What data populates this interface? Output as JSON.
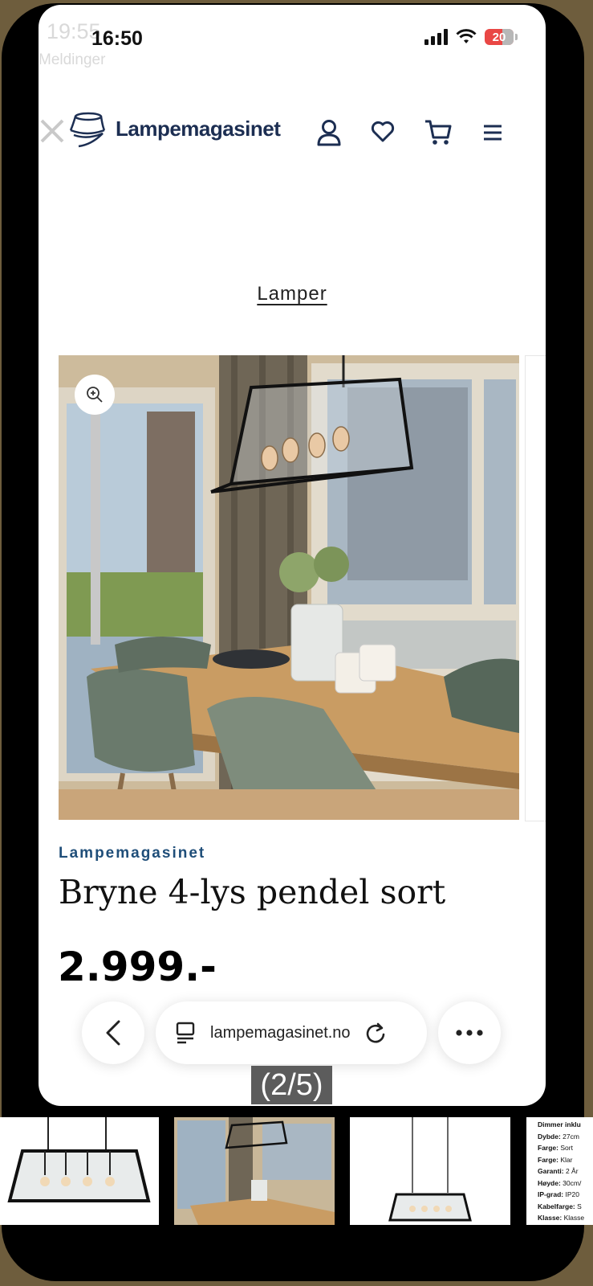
{
  "underlay": {
    "time": "19:55",
    "notification_label": "Meldinger"
  },
  "status_bar": {
    "time": "16:50",
    "battery": "20"
  },
  "header": {
    "logo_text": "Lampemagasinet",
    "icons": [
      "close-icon",
      "account-icon",
      "heart-icon",
      "cart-icon",
      "menu-icon"
    ]
  },
  "breadcrumb": "Lamper",
  "product": {
    "brand": "Lampemagasinet",
    "title": "Bryne 4-lys pendel sort",
    "price": "2.999.-"
  },
  "browser": {
    "url": "lampemagasinet.no",
    "icons": [
      "back-icon",
      "tabs-icon",
      "reload-icon",
      "more-icon"
    ]
  },
  "gallery": {
    "counter": "(2/5)"
  },
  "specs": [
    {
      "label": "Dimmer inklu",
      "value": ""
    },
    {
      "label": "Dybde:",
      "value": "27cm"
    },
    {
      "label": "Farge:",
      "value": "Sort"
    },
    {
      "label": "Farge:",
      "value": "Klar"
    },
    {
      "label": "Garanti:",
      "value": "2 År"
    },
    {
      "label": "Høyde:",
      "value": "30cm/"
    },
    {
      "label": "IP-grad:",
      "value": "IP20"
    },
    {
      "label": "Kabelfarge:",
      "value": "S"
    },
    {
      "label": "Klasse:",
      "value": "Klasse"
    }
  ],
  "colors": {
    "brand_navy": "#1c2e52",
    "brand_blue": "#1f4e79",
    "frame": "#6e5d3d",
    "battery_red": "#e94745"
  }
}
